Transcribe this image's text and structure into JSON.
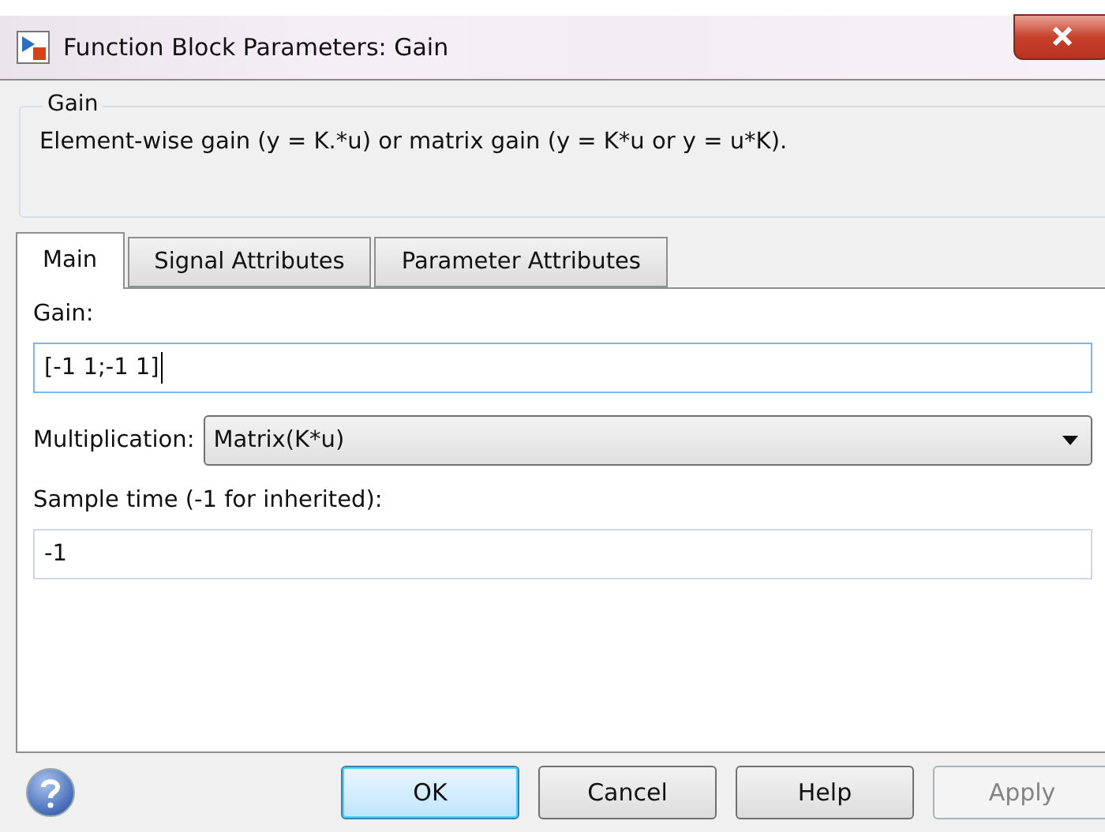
{
  "window": {
    "title": "Function Block Parameters: Gain"
  },
  "group": {
    "title": "Gain",
    "description": "Element-wise gain (y = K.*u) or matrix gain (y = K*u or y = u*K)."
  },
  "tabs": [
    {
      "label": "Main",
      "selected": true
    },
    {
      "label": "Signal Attributes",
      "selected": false
    },
    {
      "label": "Parameter Attributes",
      "selected": false
    }
  ],
  "fields": [
    {
      "kind": "text",
      "label": "Gain:",
      "value": "[-1 1;-1 1]",
      "focused": true
    },
    {
      "kind": "dropdown",
      "label": "Multiplication:",
      "value": "Matrix(K*u)",
      "focused": false
    },
    {
      "kind": "text",
      "label": "Sample time (-1 for inherited):",
      "value": "-1",
      "focused": false
    }
  ],
  "buttons": [
    {
      "label": "OK",
      "default": true,
      "disabled": false
    },
    {
      "label": "Cancel",
      "default": false,
      "disabled": false
    },
    {
      "label": "Help",
      "default": false,
      "disabled": false
    },
    {
      "label": "Apply",
      "default": false,
      "disabled": true
    }
  ]
}
